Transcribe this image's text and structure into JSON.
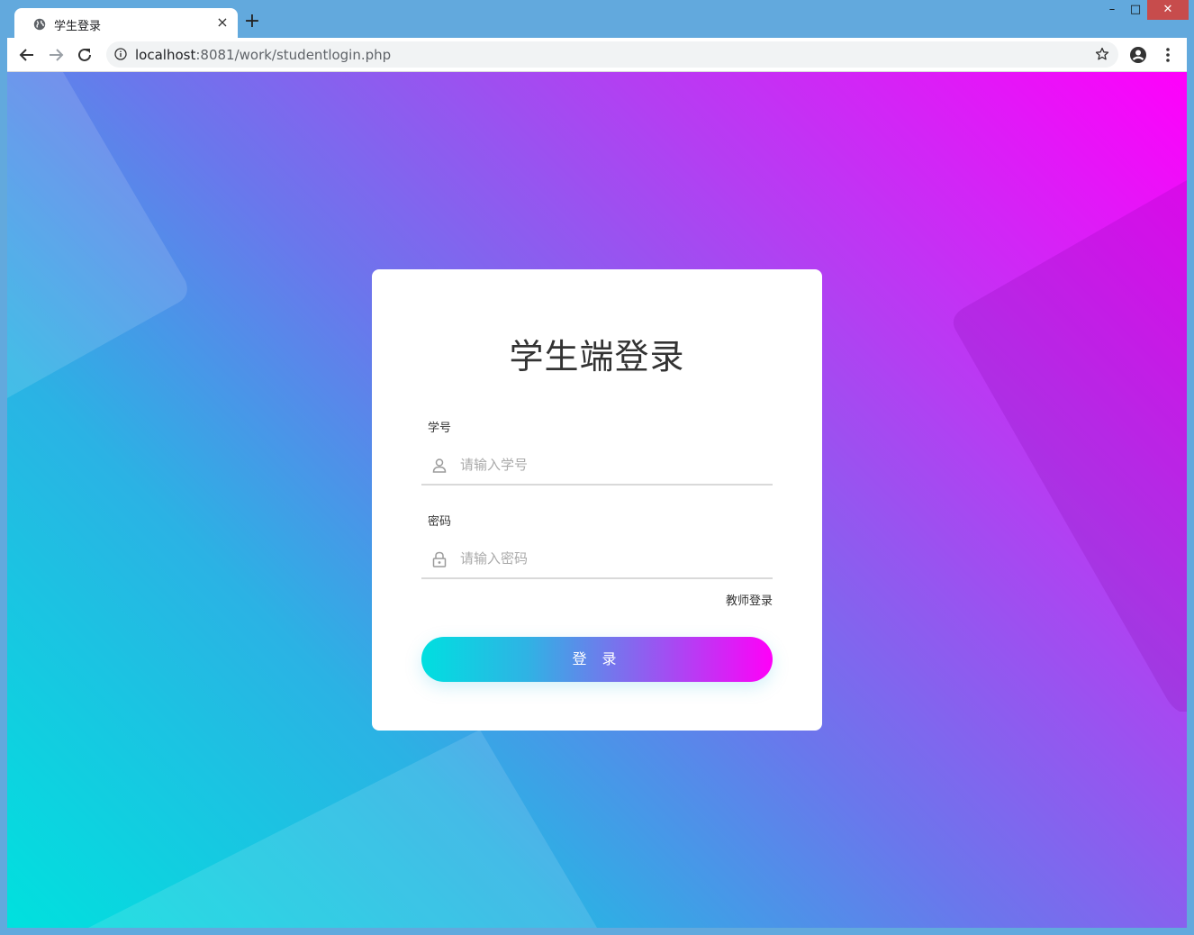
{
  "browser": {
    "tab_title": "学生登录",
    "tab_close": "×",
    "new_tab": "+",
    "url_host": "localhost",
    "url_rest": ":8081/work/studentlogin.php",
    "window_controls": {
      "minimize": "–",
      "maximize": "□",
      "close": "✕"
    }
  },
  "login": {
    "title": "学生端登录",
    "student_id_label": "学号",
    "student_id_placeholder": "请输入学号",
    "password_label": "密码",
    "password_placeholder": "请输入密码",
    "teacher_login_link": "教师登录",
    "submit_label": "登 录"
  },
  "icons": {
    "favicon": "globe-icon",
    "back": "arrow-left-icon",
    "forward": "arrow-right-icon",
    "reload": "reload-icon",
    "site_info": "info-icon",
    "bookmark": "star-icon",
    "profile": "account-circle-icon",
    "menu": "kebab-menu-icon",
    "user": "user-icon",
    "lock": "lock-icon"
  },
  "colors": {
    "gradient_start": "#00e1de",
    "gradient_end": "#ff00fb",
    "window_frame": "#62a9dd",
    "close_button": "#c74c4c"
  }
}
